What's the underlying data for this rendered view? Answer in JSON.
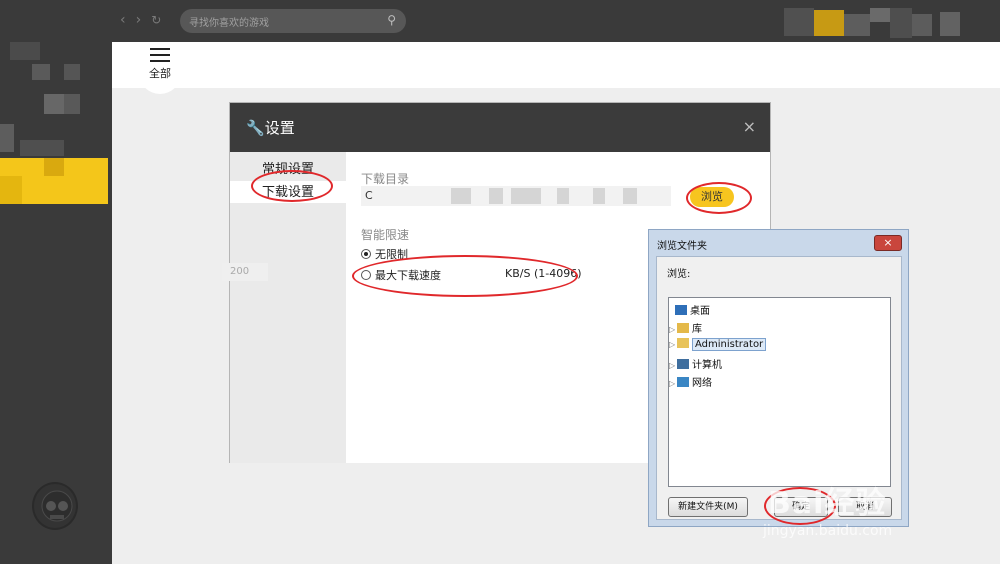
{
  "topbar": {
    "search_placeholder": "寻找你喜欢的游戏",
    "nav_back": "‹",
    "nav_forward": "›",
    "nav_refresh": "↻"
  },
  "tabstrip": {
    "all_label": "全部"
  },
  "settings_dialog": {
    "title": "设置",
    "close": "×",
    "nav": {
      "general": "常规设置",
      "download": "下载设置"
    },
    "download_dir_title": "下载目录",
    "download_dir_value": "C",
    "browse_label": "浏览",
    "speed_title": "智能限速",
    "option_unlimited": "无限制",
    "option_max": "最大下载速度",
    "speed_value": "200",
    "speed_unit": "KB/S (1-4096)"
  },
  "browse_folder_dialog": {
    "title": "浏览文件夹",
    "close": "×",
    "label": "浏览:",
    "tree": [
      "桌面",
      "库",
      "Administrator",
      "计算机",
      "网络"
    ],
    "new_folder_button": "新建文件夹(M)",
    "ok_button": "确定",
    "cancel_button": "取消"
  },
  "watermark": {
    "brand": "Bai经验",
    "url": "jingyan.baidu.com"
  },
  "colors": {
    "accent": "#f7c51f",
    "annotation": "#e0282b",
    "dark": "#3a3a3a"
  }
}
